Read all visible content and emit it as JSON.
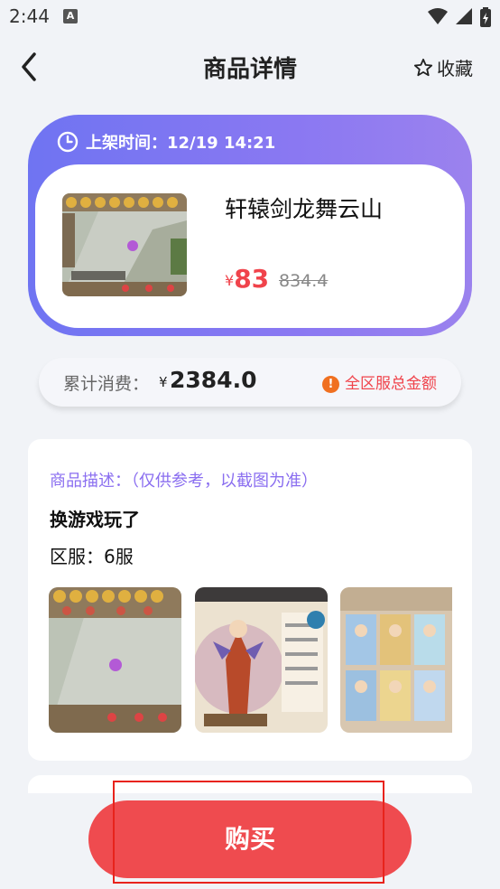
{
  "status_bar": {
    "time": "2:44",
    "notif_letter": "A"
  },
  "header": {
    "title": "商品详情",
    "favorite_label": "收藏"
  },
  "product": {
    "listed_label": "上架时间：12/19 14:21",
    "name": "轩辕剑龙舞云山",
    "currency": "¥",
    "price": "83",
    "original_price": "834.4"
  },
  "spending": {
    "label": "累计消费：",
    "currency": "¥",
    "value": "2384.0",
    "note_icon": "!",
    "note": "全区服总金额"
  },
  "description": {
    "label": "商品描述：（仅供参考，以截图为准）",
    "text": "换游戏玩了",
    "server": "区服：6服",
    "screenshots": [
      "screenshot-1",
      "screenshot-2",
      "screenshot-3"
    ]
  },
  "actions": {
    "buy_label": "购买"
  },
  "colors": {
    "accent_purple": "#7b76f2",
    "price_red": "#f0434b",
    "buy_red": "#ef4b4f",
    "highlight_border": "#e8231c"
  }
}
